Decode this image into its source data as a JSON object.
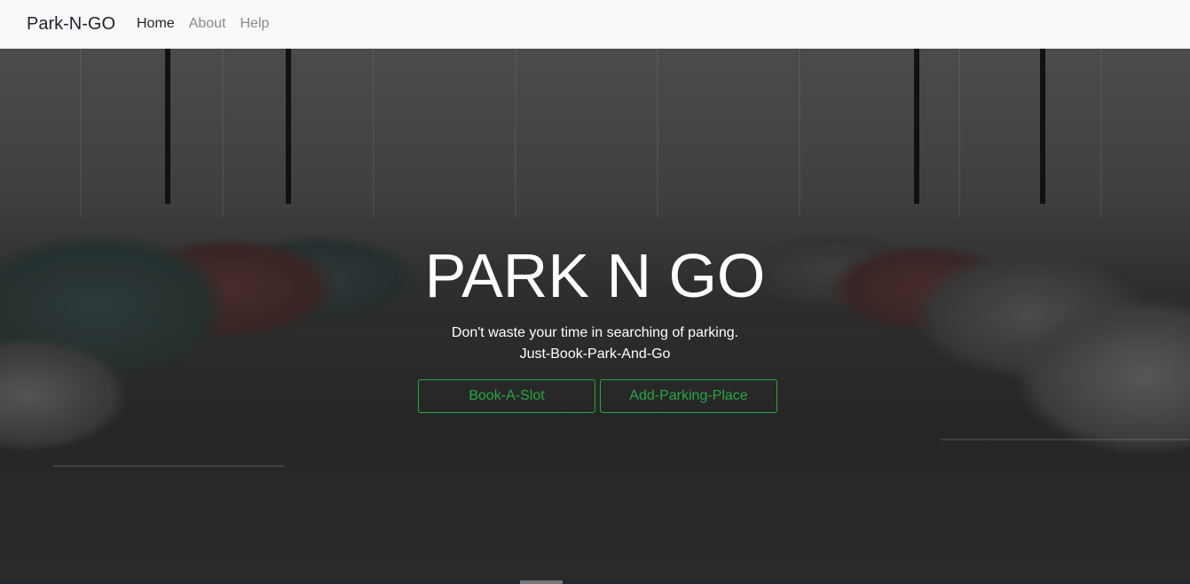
{
  "navbar": {
    "brand": "Park-N-GO",
    "links": [
      {
        "label": "Home",
        "active": true
      },
      {
        "label": "About",
        "active": false
      },
      {
        "label": "Help",
        "active": false
      }
    ]
  },
  "hero": {
    "title": "PARK N GO",
    "subtitle_line1": "Don't waste your time in searching of parking.",
    "subtitle_line2": "Just-Book-Park-And-Go",
    "buttons": {
      "book_slot": "Book-A-Slot",
      "add_parking": "Add-Parking-Place"
    }
  },
  "colors": {
    "accent": "#28a745",
    "navbar_bg": "#f8f9fa",
    "hero_overlay": "#262626"
  }
}
